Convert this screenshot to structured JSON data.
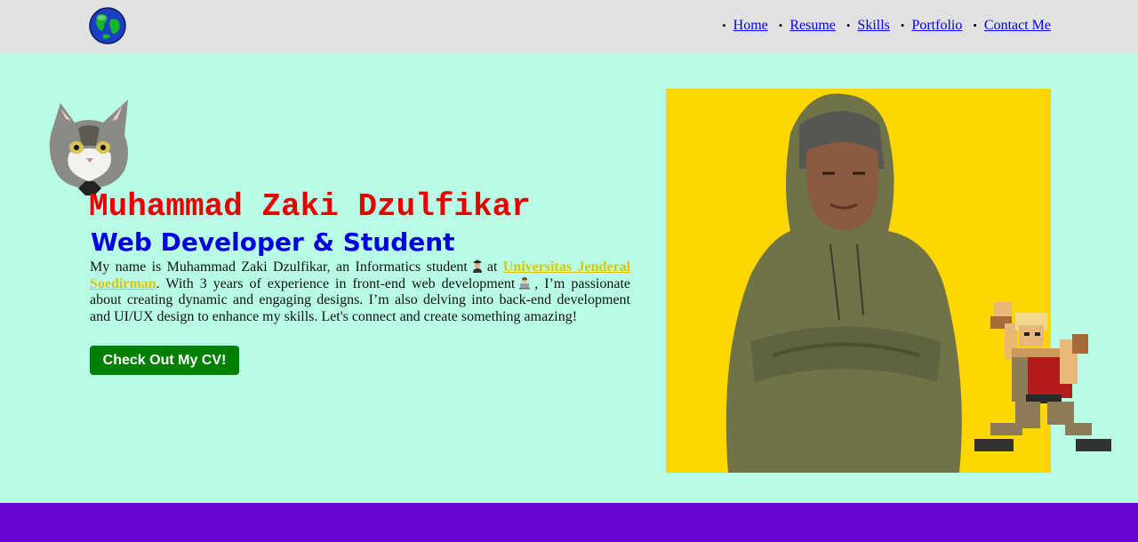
{
  "header": {
    "logo_icon": "globe-icon",
    "nav": [
      {
        "label": "Home"
      },
      {
        "label": "Resume"
      },
      {
        "label": "Skills"
      },
      {
        "label": "Portfolio"
      },
      {
        "label": "Contact Me"
      }
    ]
  },
  "hero": {
    "name": "Muhammad Zaki Dzulfikar",
    "role": "Web Developer & Student",
    "bio_part1": "My name is Muhammad Zaki Dzulfikar, an Informatics student",
    "bio_part2": "at",
    "university_link": "Universitas Jenderal Soedirman",
    "bio_part3": ". With 3 years of experience in front-end web development",
    "bio_part4": ", I’m passionate about creating dynamic and engaging designs. I’m also delving into back-end development and UI/UX design to enhance my skills. Let's connect and create something amazing!",
    "cta_label": "Check Out My CV!",
    "icons": [
      "graduate-emoji",
      "technologist-emoji",
      "cat-image",
      "profile-photo",
      "pixel-soldier-sprite"
    ]
  },
  "colors": {
    "background": "#b8fce8",
    "header_bg": "#e1e1e1",
    "name": "#e80000",
    "role": "#0000e0",
    "link": "#d8c600",
    "button": "#008000",
    "photo_bg": "#ffd700",
    "footer_band": "#6a06d4"
  }
}
